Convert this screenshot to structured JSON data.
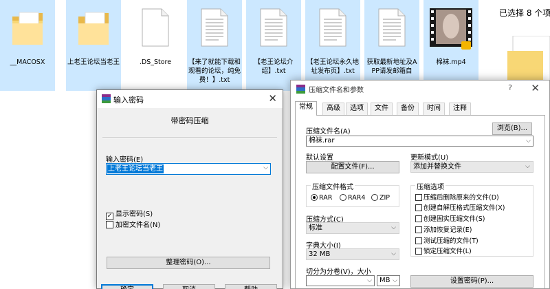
{
  "explorer": {
    "files": [
      {
        "name": "__MACOSX",
        "type": "folder",
        "selected": true
      },
      {
        "name": "上老王论坛当老王",
        "type": "folder",
        "selected": true
      },
      {
        "name": ".DS_Store",
        "type": "file",
        "selected": false
      },
      {
        "name": "【来了就能下载和观看的论坛，纯免费！】.txt",
        "type": "doc",
        "selected": true
      },
      {
        "name": "【老王论坛介绍】.txt",
        "type": "doc",
        "selected": true
      },
      {
        "name": "【老王论坛永久地址发布页】.txt",
        "type": "doc",
        "selected": true
      },
      {
        "name": "获取最新地址及APP请发邮箱自",
        "type": "doc",
        "selected": true
      },
      {
        "name": "棉袜.mp4",
        "type": "video",
        "selected": true
      }
    ],
    "selection_text": "已选择 8 个项"
  },
  "password_dialog": {
    "title": "输入密码",
    "subtitle": "带密码压缩",
    "password_label": "输入密码(E)",
    "password_value": "上老王论坛当老王",
    "show_password_label": "显示密码(S)",
    "show_password_checked": true,
    "encrypt_names_label": "加密文件名(N)",
    "encrypt_names_checked": false,
    "organize_button": "整理密码(O)...",
    "ok_button": "确定",
    "cancel_button": "取消",
    "help_button": "帮助"
  },
  "archive_dialog": {
    "title": "压缩文件名和参数",
    "help_glyph": "?",
    "tabs": [
      "常规",
      "高级",
      "选项",
      "文件",
      "备份",
      "时间",
      "注释"
    ],
    "active_tab": 0,
    "archive_name_label": "压缩文件名(A)",
    "archive_name_value": "棉袜.rar",
    "browse_button": "浏览(B)...",
    "default_settings_label": "默认设置",
    "profiles_button": "配置文件(F)...",
    "update_mode_label": "更新模式(U)",
    "update_mode_value": "添加并替换文件",
    "format_group_title": "压缩文件格式",
    "formats": [
      "RAR",
      "RAR4",
      "ZIP"
    ],
    "selected_format": "RAR",
    "method_label": "压缩方式(C)",
    "method_value": "标准",
    "dict_label": "字典大小(I)",
    "dict_value": "32 MB",
    "split_label": "切分为分卷(V)，大小",
    "split_unit": "MB",
    "options_group_title": "压缩选项",
    "options": [
      {
        "label": "压缩后删除原来的文件(D)",
        "checked": false
      },
      {
        "label": "创建自解压格式压缩文件(X)",
        "checked": false
      },
      {
        "label": "创建固实压缩文件(S)",
        "checked": false
      },
      {
        "label": "添加恢复记录(E)",
        "checked": false
      },
      {
        "label": "测试压缩的文件(T)",
        "checked": false
      },
      {
        "label": "锁定压缩文件(L)",
        "checked": false
      }
    ],
    "set_password_button": "设置密码(P)..."
  }
}
